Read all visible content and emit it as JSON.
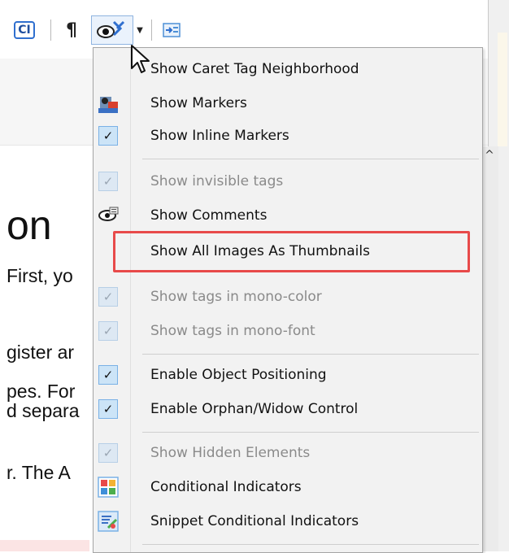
{
  "toolbar": {
    "ci_label": "CI",
    "paragraph_glyph": "¶"
  },
  "document": {
    "heading": "on",
    "lines": [
      "First, yo",
      "gister ar",
      "pes. For",
      "d separa",
      "r. The A"
    ]
  },
  "menu": {
    "items": [
      {
        "label": "Show Caret Tag Neighborhood",
        "icon": "none",
        "checked": false,
        "disabled": false
      },
      {
        "label": "Show Markers",
        "icon": "markers-icon",
        "checked": false,
        "disabled": false
      },
      {
        "label": "Show Inline Markers",
        "icon": "check-icon",
        "checked": true,
        "disabled": false
      },
      {
        "label": "Show invisible tags",
        "icon": "check-icon",
        "checked": true,
        "disabled": true
      },
      {
        "label": "Show Comments",
        "icon": "comments-icon",
        "checked": false,
        "disabled": false
      },
      {
        "label": "Show All Images As Thumbnails",
        "icon": "none",
        "checked": false,
        "disabled": false
      },
      {
        "label": "Show tags in mono-color",
        "icon": "check-icon",
        "checked": true,
        "disabled": true
      },
      {
        "label": "Show tags in mono-font",
        "icon": "check-icon",
        "checked": true,
        "disabled": true
      },
      {
        "label": "Enable Object Positioning",
        "icon": "check-icon",
        "checked": true,
        "disabled": false
      },
      {
        "label": "Enable Orphan/Widow Control",
        "icon": "check-icon",
        "checked": true,
        "disabled": false
      },
      {
        "label": "Show Hidden Elements",
        "icon": "check-icon",
        "checked": true,
        "disabled": true
      },
      {
        "label": "Conditional Indicators",
        "icon": "conditional-indicators-icon",
        "checked": false,
        "disabled": false
      },
      {
        "label": "Snippet Conditional Indicators",
        "icon": "snippet-conditional-icon",
        "checked": false,
        "disabled": false
      }
    ]
  },
  "colors": {
    "highlight": "#e84a4a",
    "check_bg": "#cce4f7",
    "menu_bg": "#f2f2f2"
  }
}
